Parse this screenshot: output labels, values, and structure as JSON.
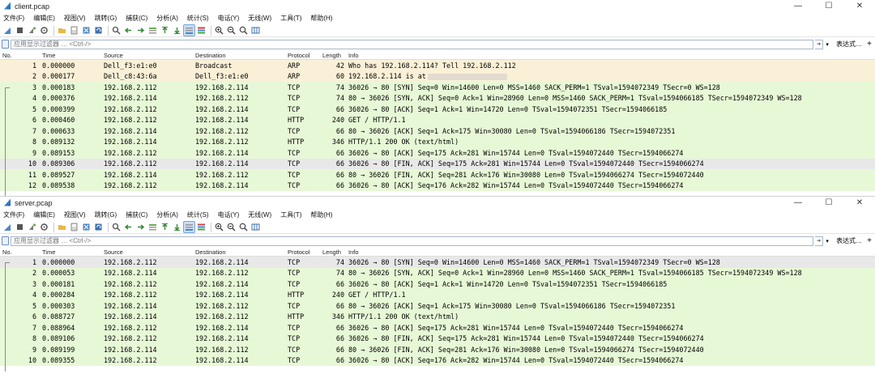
{
  "columns": [
    "No.",
    "Time",
    "Source",
    "Destination",
    "Protocol",
    "Length",
    "Info"
  ],
  "menu": [
    "文件(F)",
    "编辑(E)",
    "视图(V)",
    "跳转(G)",
    "捕获(C)",
    "分析(A)",
    "统计(S)",
    "电话(Y)",
    "无线(W)",
    "工具(T)",
    "帮助(H)"
  ],
  "filter": {
    "placeholder": "应用显示过滤器 … <Ctrl-/>",
    "expression_label": "表达式…",
    "plus_label": "+"
  },
  "window_controls": {
    "minimize": "—",
    "maximize": "☐",
    "close": "✕"
  },
  "colors": {
    "tcp_row": "#e7f8d6",
    "arp_row": "#faf0d7",
    "selected_row": "#e8e8e8"
  },
  "client": {
    "title": "client.pcap",
    "rows": [
      {
        "no": "1",
        "time": "0.000000",
        "source": "Dell_f3:e1:e0",
        "destination": "Broadcast",
        "protocol": "ARP",
        "length": "42",
        "info": "Who has 192.168.2.114? Tell 192.168.2.112",
        "style": "arp"
      },
      {
        "no": "2",
        "time": "0.000177",
        "source": "Dell_c8:43:6a",
        "destination": "Dell_f3:e1:e0",
        "protocol": "ARP",
        "length": "60",
        "info": "192.168.2.114 is at",
        "style": "arp",
        "redacted": true
      },
      {
        "no": "3",
        "time": "0.000183",
        "source": "192.168.2.112",
        "destination": "192.168.2.114",
        "protocol": "TCP",
        "length": "74",
        "info": "36026 → 80 [SYN] Seq=0 Win=14600 Len=0 MSS=1460 SACK_PERM=1 TSval=1594072349 TSecr=0 WS=128",
        "style": "tcp"
      },
      {
        "no": "4",
        "time": "0.000376",
        "source": "192.168.2.114",
        "destination": "192.168.2.112",
        "protocol": "TCP",
        "length": "74",
        "info": "80 → 36026 [SYN, ACK] Seq=0 Ack=1 Win=28960 Len=0 MSS=1460 SACK_PERM=1 TSval=1594066185 TSecr=1594072349 WS=128",
        "style": "tcp"
      },
      {
        "no": "5",
        "time": "0.000399",
        "source": "192.168.2.112",
        "destination": "192.168.2.114",
        "protocol": "TCP",
        "length": "66",
        "info": "36026 → 80 [ACK] Seq=1 Ack=1 Win=14720 Len=0 TSval=1594072351 TSecr=1594066185",
        "style": "tcp"
      },
      {
        "no": "6",
        "time": "0.000460",
        "source": "192.168.2.112",
        "destination": "192.168.2.114",
        "protocol": "HTTP",
        "length": "240",
        "info": "GET / HTTP/1.1",
        "style": "tcp"
      },
      {
        "no": "7",
        "time": "0.000633",
        "source": "192.168.2.114",
        "destination": "192.168.2.112",
        "protocol": "TCP",
        "length": "66",
        "info": "80 → 36026 [ACK] Seq=1 Ack=175 Win=30080 Len=0 TSval=1594066186 TSecr=1594072351",
        "style": "tcp"
      },
      {
        "no": "8",
        "time": "0.089132",
        "source": "192.168.2.114",
        "destination": "192.168.2.112",
        "protocol": "HTTP",
        "length": "346",
        "info": "HTTP/1.1 200 OK  (text/html)",
        "style": "tcp"
      },
      {
        "no": "9",
        "time": "0.089153",
        "source": "192.168.2.112",
        "destination": "192.168.2.114",
        "protocol": "TCP",
        "length": "66",
        "info": "36026 → 80 [ACK] Seq=175 Ack=281 Win=15744 Len=0 TSval=1594072440 TSecr=1594066274",
        "style": "tcp"
      },
      {
        "no": "10",
        "time": "0.089306",
        "source": "192.168.2.112",
        "destination": "192.168.2.114",
        "protocol": "TCP",
        "length": "66",
        "info": "36026 → 80 [FIN, ACK] Seq=175 Ack=281 Win=15744 Len=0 TSval=1594072440 TSecr=1594066274",
        "style": "sel"
      },
      {
        "no": "11",
        "time": "0.089527",
        "source": "192.168.2.114",
        "destination": "192.168.2.112",
        "protocol": "TCP",
        "length": "66",
        "info": "80 → 36026 [FIN, ACK] Seq=281 Ack=176 Win=30080 Len=0 TSval=1594066274 TSecr=1594072440",
        "style": "tcp"
      },
      {
        "no": "12",
        "time": "0.089538",
        "source": "192.168.2.112",
        "destination": "192.168.2.114",
        "protocol": "TCP",
        "length": "66",
        "info": "36026 → 80 [ACK] Seq=176 Ack=282 Win=15744 Len=0 TSval=1594072440 TSecr=1594066274",
        "style": "tcp"
      }
    ]
  },
  "server": {
    "title": "server.pcap",
    "rows": [
      {
        "no": "1",
        "time": "0.000000",
        "source": "192.168.2.112",
        "destination": "192.168.2.114",
        "protocol": "TCP",
        "length": "74",
        "info": "36026 → 80 [SYN] Seq=0 Win=14600 Len=0 MSS=1460 SACK_PERM=1 TSval=1594072349 TSecr=0 WS=128",
        "style": "sel"
      },
      {
        "no": "2",
        "time": "0.000053",
        "source": "192.168.2.114",
        "destination": "192.168.2.112",
        "protocol": "TCP",
        "length": "74",
        "info": "80 → 36026 [SYN, ACK] Seq=0 Ack=1 Win=28960 Len=0 MSS=1460 SACK_PERM=1 TSval=1594066185 TSecr=1594072349 WS=128",
        "style": "tcp"
      },
      {
        "no": "3",
        "time": "0.000181",
        "source": "192.168.2.112",
        "destination": "192.168.2.114",
        "protocol": "TCP",
        "length": "66",
        "info": "36026 → 80 [ACK] Seq=1 Ack=1 Win=14720 Len=0 TSval=1594072351 TSecr=1594066185",
        "style": "tcp"
      },
      {
        "no": "4",
        "time": "0.000284",
        "source": "192.168.2.112",
        "destination": "192.168.2.114",
        "protocol": "HTTP",
        "length": "240",
        "info": "GET / HTTP/1.1",
        "style": "tcp"
      },
      {
        "no": "5",
        "time": "0.000303",
        "source": "192.168.2.114",
        "destination": "192.168.2.112",
        "protocol": "TCP",
        "length": "66",
        "info": "80 → 36026 [ACK] Seq=1 Ack=175 Win=30080 Len=0 TSval=1594066186 TSecr=1594072351",
        "style": "tcp"
      },
      {
        "no": "6",
        "time": "0.088727",
        "source": "192.168.2.114",
        "destination": "192.168.2.112",
        "protocol": "HTTP",
        "length": "346",
        "info": "HTTP/1.1 200 OK  (text/html)",
        "style": "tcp"
      },
      {
        "no": "7",
        "time": "0.088964",
        "source": "192.168.2.112",
        "destination": "192.168.2.114",
        "protocol": "TCP",
        "length": "66",
        "info": "36026 → 80 [ACK] Seq=175 Ack=281 Win=15744 Len=0 TSval=1594072440 TSecr=1594066274",
        "style": "tcp"
      },
      {
        "no": "8",
        "time": "0.089106",
        "source": "192.168.2.112",
        "destination": "192.168.2.114",
        "protocol": "TCP",
        "length": "66",
        "info": "36026 → 80 [FIN, ACK] Seq=175 Ack=281 Win=15744 Len=0 TSval=1594072440 TSecr=1594066274",
        "style": "tcp"
      },
      {
        "no": "9",
        "time": "0.089199",
        "source": "192.168.2.114",
        "destination": "192.168.2.112",
        "protocol": "TCP",
        "length": "66",
        "info": "80 → 36026 [FIN, ACK] Seq=281 Ack=176 Win=30080 Len=0 TSval=1594066274 TSecr=1594072440",
        "style": "tcp"
      },
      {
        "no": "10",
        "time": "0.089355",
        "source": "192.168.2.112",
        "destination": "192.168.2.114",
        "protocol": "TCP",
        "length": "66",
        "info": "36026 → 80 [ACK] Seq=176 Ack=282 Win=15744 Len=0 TSval=1594072440 TSecr=1594066274",
        "style": "tcp"
      }
    ]
  }
}
